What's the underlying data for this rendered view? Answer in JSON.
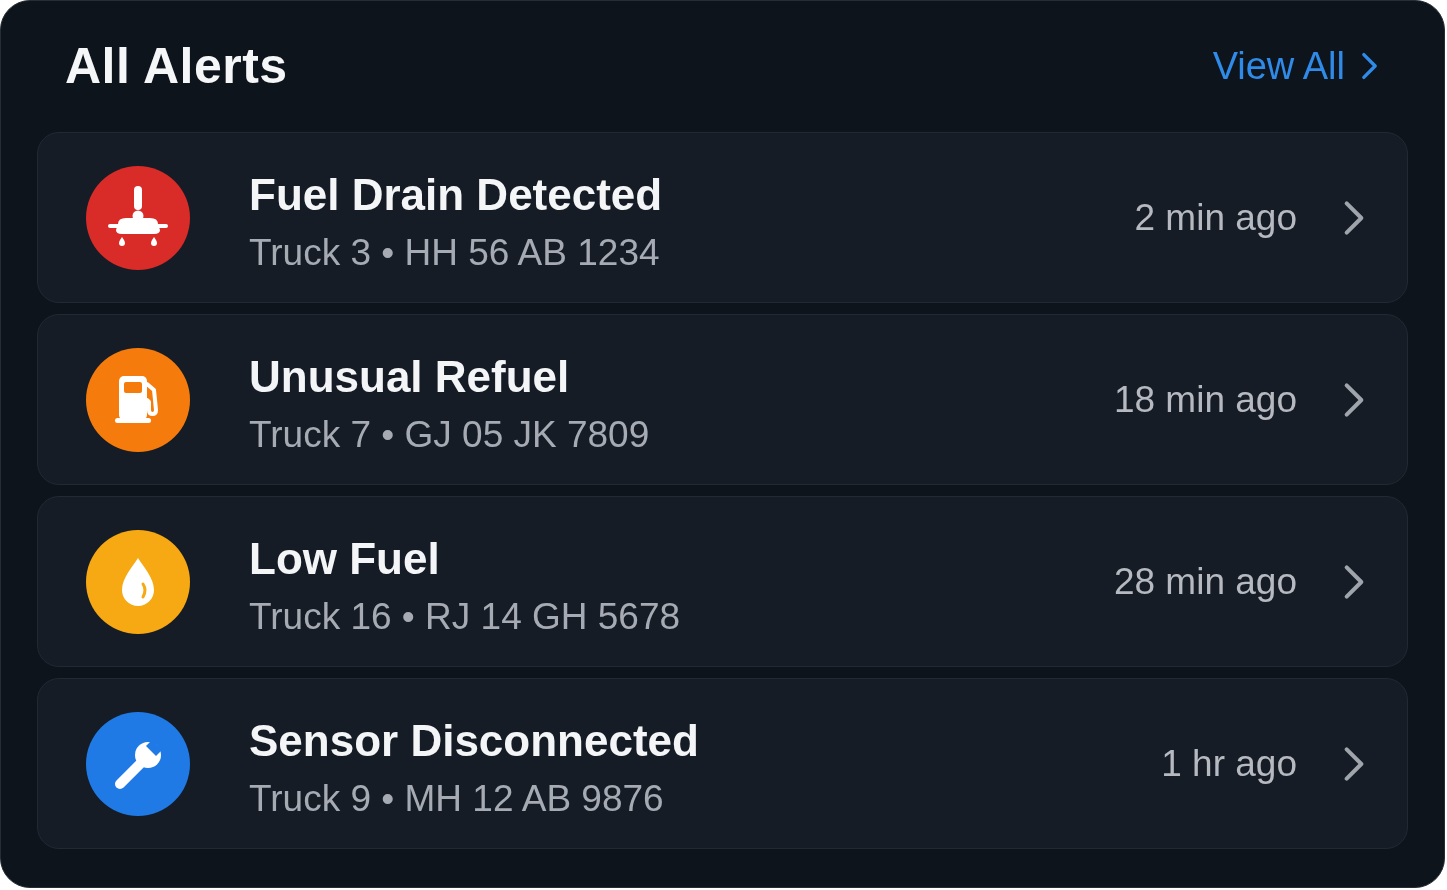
{
  "header": {
    "title": "All Alerts",
    "link": "View All"
  },
  "alerts": [
    {
      "kind": "drain",
      "color": "#d92b27",
      "title": "Fuel Drain Detected",
      "detail": "Truck 3 • HH 56 AB 1234",
      "time": "2 min ago"
    },
    {
      "kind": "refuel",
      "color": "#f57c0c",
      "title": "Unusual Refuel",
      "detail": "Truck 7 • GJ 05 JK 7809",
      "time": "18 min ago"
    },
    {
      "kind": "low_fuel",
      "color": "#f6a912",
      "title": "Low Fuel",
      "detail": "Truck 16 • RJ 14 GH 5678",
      "time": "28 min ago"
    },
    {
      "kind": "sensor",
      "color": "#1f7ae6",
      "title": "Sensor Disconnected",
      "detail": "Truck 9 • MH 12 AB 9876",
      "time": "1 hr ago"
    }
  ]
}
